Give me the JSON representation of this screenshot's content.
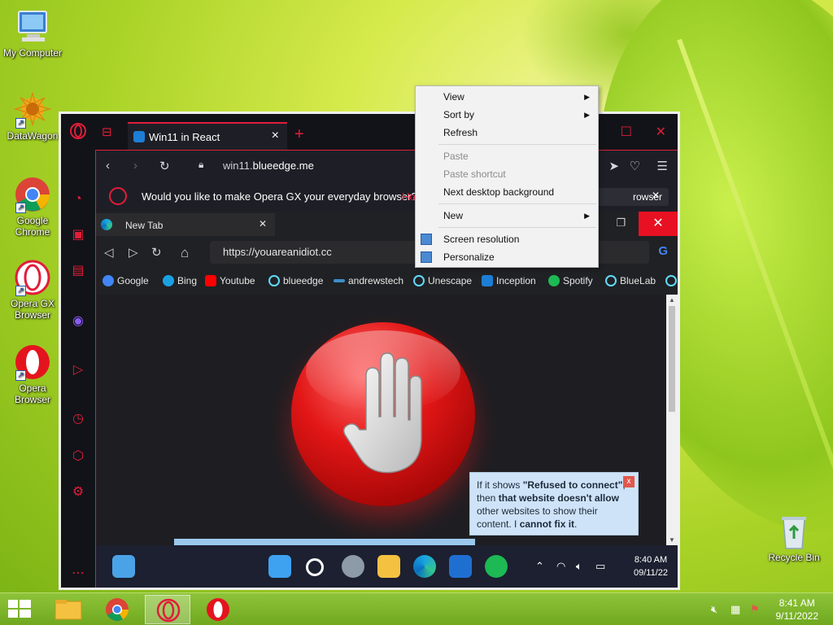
{
  "desktop": {
    "icons": [
      {
        "label": "My Computer"
      },
      {
        "label": "DataWagon"
      },
      {
        "label": "Google Chrome"
      },
      {
        "label": "Opera GX Browser"
      },
      {
        "label": "Opera Browser"
      },
      {
        "label": "Recycle Bin"
      }
    ]
  },
  "gx": {
    "tab_title": "Win11 in React",
    "address": {
      "url_prefix": "win11.",
      "url_domain": "blueedge.me"
    },
    "promo": {
      "text": "Would you like to make Opera GX your everyday browser?",
      "link": "Ho",
      "button": "rowser"
    }
  },
  "inner_browser": {
    "tab_title": "New Tab",
    "address": "https://youareanidiot.cc",
    "bookmarks": [
      {
        "label": "Google",
        "color": "#4285f4"
      },
      {
        "label": "Bing",
        "color": "#1ba1e2"
      },
      {
        "label": "Youtube",
        "color": "#ff0000"
      },
      {
        "label": "blueedge",
        "color": "#61dafb"
      },
      {
        "label": "andrewstech",
        "color": "#3c8ec8"
      },
      {
        "label": "Unescape",
        "color": "#61dafb"
      },
      {
        "label": "Inception",
        "color": "#1d7ed6"
      },
      {
        "label": "Spotify",
        "color": "#1db954"
      },
      {
        "label": "BlueLab",
        "color": "#61dafb"
      }
    ],
    "taskbar_clock": {
      "time": "8:40 AM",
      "date": "09/11/22"
    }
  },
  "tooltip": {
    "part1": "If it shows ",
    "bold1": "\"Refused to connect\"",
    "part2": ", then ",
    "bold2": "that website doesn't allow",
    "part3": " other websites to show their content. I ",
    "bold3": "cannot fix it",
    "part4": ".",
    "close": "x"
  },
  "context_menu": {
    "items": [
      {
        "label": "View",
        "submenu": true,
        "disabled": false
      },
      {
        "label": "Sort by",
        "submenu": true,
        "disabled": false
      },
      {
        "label": "Refresh",
        "submenu": false,
        "disabled": false
      },
      {
        "label": "Paste",
        "submenu": false,
        "disabled": true
      },
      {
        "label": "Paste shortcut",
        "submenu": false,
        "disabled": true
      },
      {
        "label": "Next desktop background",
        "submenu": false,
        "disabled": false
      },
      {
        "label": "New",
        "submenu": true,
        "disabled": false
      },
      {
        "label": "Screen resolution",
        "submenu": false,
        "disabled": false
      },
      {
        "label": "Personalize",
        "submenu": false,
        "disabled": false
      }
    ]
  },
  "taskbar": {
    "clock": {
      "time": "8:41 AM",
      "date": "9/11/2022"
    }
  },
  "colors": {
    "accent": "#e11d3a",
    "taskbar": "#7db42a"
  }
}
